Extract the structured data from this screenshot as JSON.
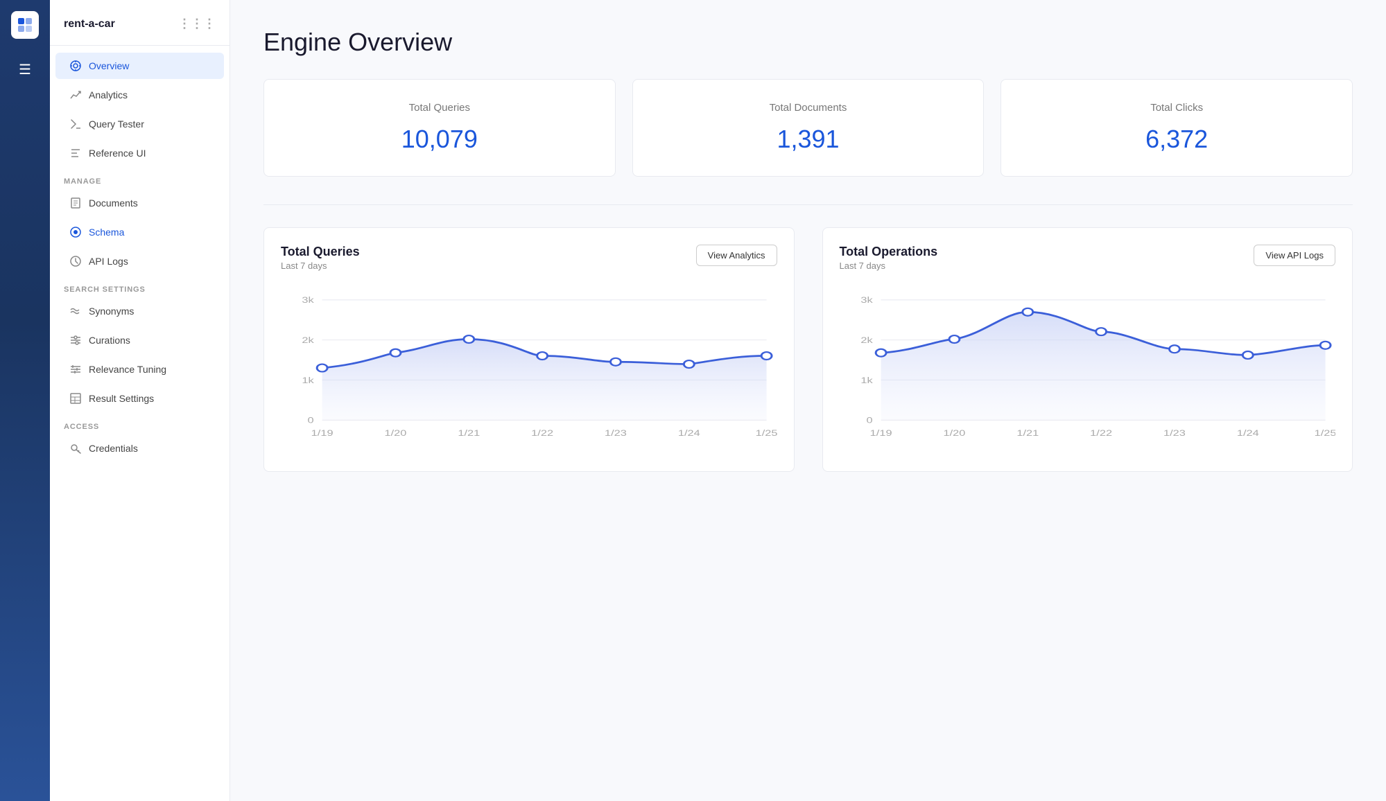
{
  "app": {
    "logo_alt": "App Logo",
    "name": "rent-a-car",
    "dots_label": "⋮⋮⋮"
  },
  "sidebar": {
    "menu_icon": "☰",
    "items": [
      {
        "id": "overview",
        "label": "Overview",
        "active": true
      },
      {
        "id": "analytics",
        "label": "Analytics",
        "active": false
      },
      {
        "id": "query-tester",
        "label": "Query Tester",
        "active": false
      },
      {
        "id": "reference-ui",
        "label": "Reference UI",
        "active": false
      }
    ],
    "sections": [
      {
        "label": "MANAGE",
        "items": [
          {
            "id": "documents",
            "label": "Documents"
          },
          {
            "id": "schema",
            "label": "Schema",
            "highlighted": true
          },
          {
            "id": "api-logs",
            "label": "API Logs"
          }
        ]
      },
      {
        "label": "SEARCH SETTINGS",
        "items": [
          {
            "id": "synonyms",
            "label": "Synonyms"
          },
          {
            "id": "curations",
            "label": "Curations"
          },
          {
            "id": "relevance-tuning",
            "label": "Relevance Tuning"
          },
          {
            "id": "result-settings",
            "label": "Result Settings"
          }
        ]
      },
      {
        "label": "ACCESS",
        "items": [
          {
            "id": "credentials",
            "label": "Credentials"
          }
        ]
      }
    ]
  },
  "main": {
    "page_title": "Engine Overview",
    "stats": [
      {
        "label": "Total Queries",
        "value": "10,079"
      },
      {
        "label": "Total Documents",
        "value": "1,391"
      },
      {
        "label": "Total Clicks",
        "value": "6,372"
      }
    ],
    "charts": [
      {
        "id": "total-queries-chart",
        "title": "Total Queries",
        "subtitle": "Last 7 days",
        "button_label": "View Analytics",
        "x_labels": [
          "1/19",
          "1/20",
          "1/21",
          "1/22",
          "1/23",
          "1/24",
          "1/25"
        ],
        "y_labels": [
          "3k",
          "2k",
          "1k",
          "0"
        ],
        "data": [
          1300,
          1700,
          2050,
          1600,
          1450,
          1400,
          1600
        ]
      },
      {
        "id": "total-operations-chart",
        "title": "Total Operations",
        "subtitle": "Last 7 days",
        "button_label": "View API Logs",
        "x_labels": [
          "1/19",
          "1/20",
          "1/21",
          "1/22",
          "1/23",
          "1/24",
          "1/25"
        ],
        "y_labels": [
          "3k",
          "2k",
          "1k",
          "0"
        ],
        "data": [
          1700,
          2050,
          2700,
          2200,
          1800,
          1650,
          1900
        ]
      }
    ]
  }
}
